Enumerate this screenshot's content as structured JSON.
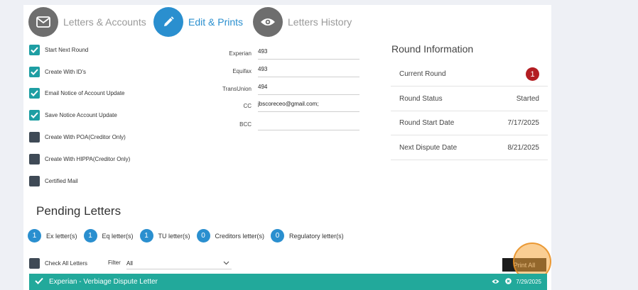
{
  "tabs": [
    {
      "label": "Letters & Accounts",
      "icon": "envelope-icon"
    },
    {
      "label": "Edit & Prints",
      "icon": "pencil-icon"
    },
    {
      "label": "Letters History",
      "icon": "eye-icon"
    }
  ],
  "options": [
    {
      "label": "Start Next Round",
      "checked": true
    },
    {
      "label": "Create With ID's",
      "checked": true
    },
    {
      "label": "Email Notice of Account Update",
      "checked": true
    },
    {
      "label": "Save Notice Account Update",
      "checked": true
    },
    {
      "label": "Create With POA(Creditor Only)",
      "checked": false
    },
    {
      "label": "Create With HIPPA(Creditor Only)",
      "checked": false
    },
    {
      "label": "Certified Mail",
      "checked": false
    }
  ],
  "fields": [
    {
      "label": "Experian",
      "value": "493"
    },
    {
      "label": "Equifax",
      "value": "493"
    },
    {
      "label": "TransUnion",
      "value": "494"
    },
    {
      "label": "CC",
      "value": "jbscoreceo@gmail.com;"
    },
    {
      "label": "BCC",
      "value": ""
    }
  ],
  "round_info": {
    "title": "Round Information",
    "rows": [
      {
        "label": "Current Round",
        "value": "1"
      },
      {
        "label": "Round Status",
        "value": "Started"
      },
      {
        "label": "Round Start Date",
        "value": "7/17/2025"
      },
      {
        "label": "Next Dispute Date",
        "value": "8/21/2025"
      }
    ]
  },
  "pending": {
    "title": "Pending Letters",
    "counts": [
      {
        "count": "1",
        "label": "Ex letter(s)"
      },
      {
        "count": "1",
        "label": "Eq letter(s)"
      },
      {
        "count": "1",
        "label": "TU letter(s)"
      },
      {
        "count": "0",
        "label": "Creditors letter(s)"
      },
      {
        "count": "0",
        "label": "Regulatory letter(s)"
      }
    ],
    "check_all_label": "Check All Letters",
    "filter_label": "Filter",
    "filter_value": "All",
    "print_all_label": "Print All"
  },
  "letters": [
    {
      "title": "Experian - Verbiage Dispute Letter",
      "date": "7/29/2025"
    }
  ],
  "colors": {
    "accent": "#2a8fcf",
    "checked": "#1e9ea3",
    "letter_bar": "#22a99b",
    "badge": "#b31d22"
  }
}
